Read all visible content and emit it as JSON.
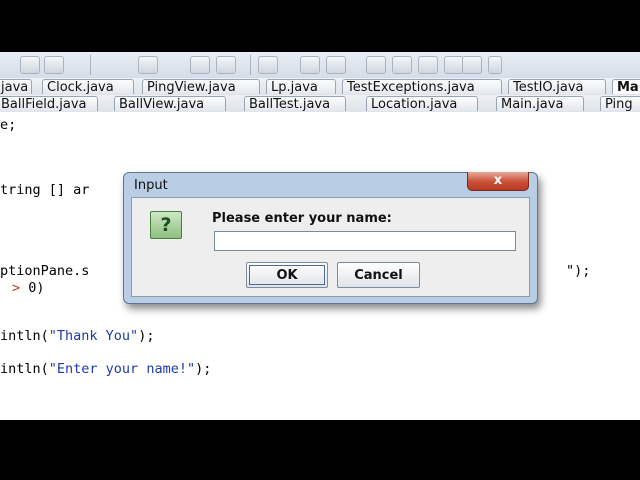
{
  "tabs_row1": [
    "java",
    "Clock.java",
    "PingView.java",
    "Lp.java",
    "TestExceptions.java",
    "TestIO.java",
    "Ma"
  ],
  "tabs_row2": [
    "BallField.java",
    "BallView.java",
    "BallTest.java",
    "Location.java",
    "Main.java",
    "Ping"
  ],
  "code": {
    "line1": "e;",
    "line2": "tring [] ar",
    "line3a": "ptionPane.s",
    "line3b": "\");",
    "line4_op": ">",
    "line4_rest": " 0)",
    "line5_pre": "intln(",
    "line5_str": "\"Thank You\"",
    "line5_post": ");",
    "line6_pre": "intln(",
    "line6_str": "\"Enter your name!\"",
    "line6_post": ");"
  },
  "dialog": {
    "title": "Input",
    "close_glyph": "x",
    "icon_glyph": "?",
    "prompt": "Please enter your name:",
    "input_value": "",
    "ok_label": "OK",
    "cancel_label": "Cancel"
  }
}
